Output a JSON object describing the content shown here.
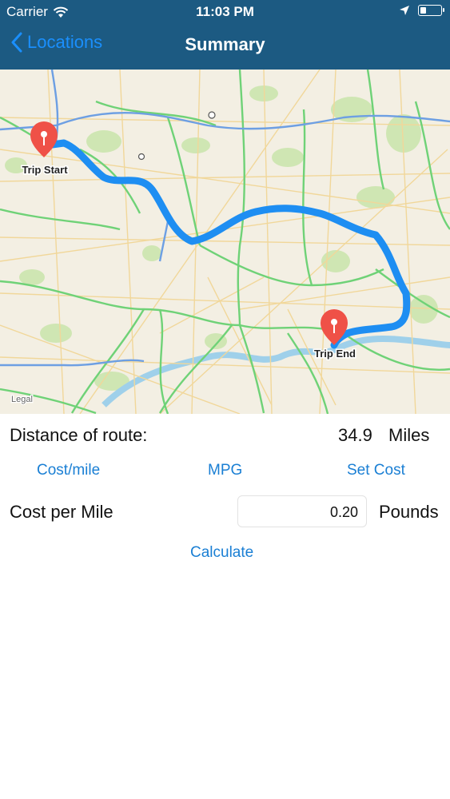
{
  "status_bar": {
    "carrier": "Carrier",
    "time": "11:03 PM",
    "icons": [
      "wifi-icon",
      "location-arrow-icon",
      "battery-icon"
    ]
  },
  "nav_bar": {
    "back_label": "Locations",
    "title": "Summary"
  },
  "map": {
    "start_label": "Trip Start",
    "end_label": "Trip End",
    "legal_label": "Legal",
    "route_color": "#1e8ef2",
    "pin_color": "#ef5147"
  },
  "summary": {
    "distance_label": "Distance of route:",
    "distance_value": "34.9",
    "distance_unit": "Miles",
    "links": {
      "cost_mile": "Cost/mile",
      "mpg": "MPG",
      "set_cost": "Set Cost"
    },
    "cost_label": "Cost per Mile",
    "cost_value": "0.20",
    "cost_unit": "Pounds",
    "calculate_label": "Calculate"
  },
  "colors": {
    "nav_background": "#1c5a82",
    "accent": "#1a8ffd"
  }
}
